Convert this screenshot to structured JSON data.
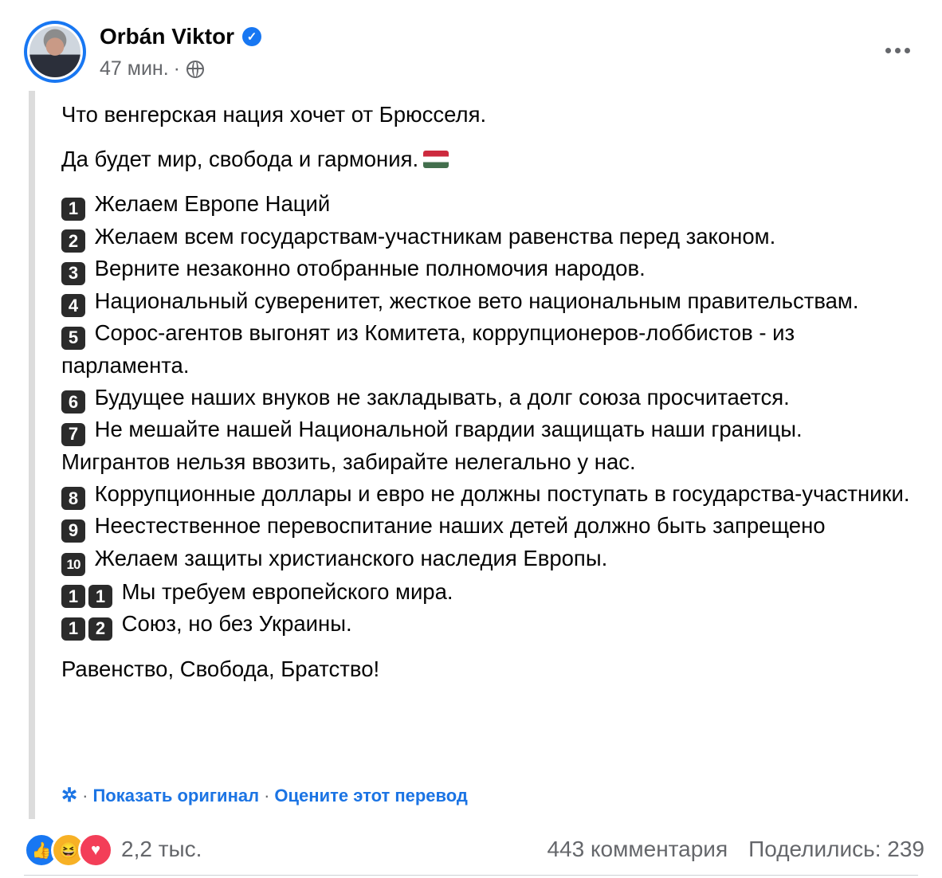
{
  "post": {
    "author": "Orbán Viktor",
    "time": "47 мин.",
    "time_sep": "·",
    "paragraphs": {
      "p1": "Что венгерская нация хочет от Брюсселя.",
      "p2": "Да будет мир, свобода и гармония."
    },
    "items": [
      {
        "num": "1",
        "text": "Желаем Европе Наций"
      },
      {
        "num": "2",
        "text": "Желаем всем государствам-участникам равенства перед законом."
      },
      {
        "num": "3",
        "text": "Верните незаконно отобранные полномочия народов."
      },
      {
        "num": "4",
        "text": "Национальный суверенитет, жесткое вето национальным правительствам."
      },
      {
        "num": "5",
        "text": "Сорос-агентов выгонят из Комитета, коррупционеров-лоббистов - из парламента."
      },
      {
        "num": "6",
        "text": "Будущее наших внуков не закладывать, а долг союза просчитается."
      },
      {
        "num": "7",
        "text": "Не мешайте нашей Национальной гвардии защищать наши границы. Мигрантов нельзя ввозить, забирайте нелегально у нас."
      },
      {
        "num": "8",
        "text": "Коррупционные доллары и евро не должны поступать в государства-участники."
      },
      {
        "num": "9",
        "text": "Неестественное перевоспитание наших детей должно быть запрещено"
      },
      {
        "num": "10",
        "text": "Желаем защиты христианского наследия Европы."
      },
      {
        "num": "11",
        "text": "Мы требуем европейского мира."
      },
      {
        "num": "12",
        "text": "Союз, но без Украины."
      }
    ],
    "closing": "Равенство, Свобода, Братство!"
  },
  "translation": {
    "sep": "·",
    "show_original": "Показать оригинал",
    "rate": "Оцените этот перевод"
  },
  "stats": {
    "reactions_count": "2,2 тыс.",
    "comments": "443 комментария",
    "shares": "Поделились: 239"
  },
  "icons": {
    "verified": "verified-badge-icon",
    "privacy": "globe-icon",
    "more": "more-horizontal-icon",
    "gear": "gear-icon",
    "flag": "hungary-flag-emoji",
    "reactions": [
      "like-icon",
      "haha-icon",
      "love-icon"
    ]
  },
  "colors": {
    "accent": "#1b74e4",
    "verified": "#1877f2",
    "secondary_text": "#65676b",
    "keycap": "#2b2b2b"
  }
}
